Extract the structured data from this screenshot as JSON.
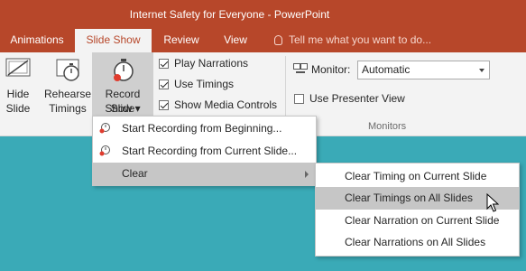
{
  "window": {
    "title": "Internet Safety for Everyone - PowerPoint"
  },
  "tabs": [
    {
      "label": "Animations",
      "active": false
    },
    {
      "label": "Slide Show",
      "active": true
    },
    {
      "label": "Review",
      "active": false
    },
    {
      "label": "View",
      "active": false
    }
  ],
  "tell_me": {
    "placeholder": "Tell me what you want to do..."
  },
  "ribbon": {
    "hide_slide": {
      "line1": "Hide",
      "line2": "Slide"
    },
    "rehearse_timings": {
      "line1": "Rehearse",
      "line2": "Timings"
    },
    "record_slide_show": {
      "line1": "Record Slide",
      "line2": "Show ▾"
    },
    "checkboxes": [
      {
        "label": "Play Narrations",
        "checked": true
      },
      {
        "label": "Use Timings",
        "checked": true
      },
      {
        "label": "Show Media Controls",
        "checked": true
      }
    ],
    "monitor": {
      "label": "Monitor:",
      "value": "Automatic"
    },
    "presenter_view": {
      "label": "Use Presenter View",
      "checked": false
    },
    "monitors_group_label": "Monitors"
  },
  "record_menu": {
    "items": [
      {
        "label": "Start Recording from Beginning...",
        "icon": "record-icon"
      },
      {
        "label": "Start Recording from Current Slide...",
        "icon": "record-icon"
      },
      {
        "label": "Clear",
        "has_submenu": true,
        "highlighted": true
      }
    ]
  },
  "clear_submenu": {
    "items": [
      {
        "label": "Clear Timing on Current Slide",
        "highlighted": false
      },
      {
        "label": "Clear Timings on All Slides",
        "highlighted": true
      },
      {
        "label": "Clear Narration on Current Slide",
        "highlighted": false
      },
      {
        "label": "Clear Narrations on All Slides",
        "highlighted": false
      }
    ]
  },
  "colors": {
    "accent": "#b7472a",
    "ribbon": "#f3f3f3",
    "slide_area": "#3aaab7",
    "highlight": "#c6c6c6"
  }
}
